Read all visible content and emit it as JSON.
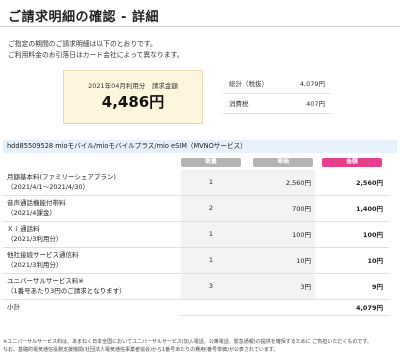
{
  "page": {
    "title": "ご請求明細の確認 - 詳細",
    "intro_line1": "ご指定の期間のご請求明細は以下のとおりです。",
    "intro_line2": "ご利用料金のお引落日はカード会社によって異なります。"
  },
  "total": {
    "caption": "2021年04月利用分　請求金額",
    "amount": "4,486円"
  },
  "summary": [
    {
      "label": "総計（税抜）",
      "value": "4,079円"
    },
    {
      "label": "消費税",
      "value": "407円"
    }
  ],
  "line": {
    "label": "hdd85509528 mioモバイル/mioモバイルプラス/mio eSIM（MVNOサービス）"
  },
  "columns": {
    "qty": "数量",
    "unit": "単価",
    "amount": "金額"
  },
  "colors": {
    "header_gray": "#b3b3b3",
    "header_pink": "#e6408c",
    "line_bar": "#e6f1fb",
    "total_box": "#fdf6dc"
  },
  "rows": [
    {
      "name1": "月額基本料(ファミリーシェアプラン)",
      "name2": "（2021/4/1〜2021/4/30）",
      "qty": "1",
      "unit": "2,560円",
      "amount": "2,560円"
    },
    {
      "name1": "音声通話機能付帯料",
      "name2": "（2021/4課金）",
      "qty": "2",
      "unit": "700円",
      "amount": "1,400円"
    },
    {
      "name1": "Ｘｉ通話料",
      "name2": "（2021/3利用分）",
      "qty": "1",
      "unit": "100円",
      "amount": "100円"
    },
    {
      "name1": "他社接続サービス通信料",
      "name2": "（2021/3利用分）",
      "qty": "1",
      "unit": "10円",
      "amount": "10円"
    },
    {
      "name1": "ユニバーサルサービス料※",
      "name2": "（1番号あたり3円のご請求となります）",
      "qty": "3",
      "unit": "3円",
      "amount": "9円"
    }
  ],
  "subtotal": {
    "label": "小計",
    "amount": "4,079円"
  },
  "footnote": {
    "line1": "※ユニバーサルサービス料は、あまねく日本全国においてユニバーサルサービス(加入電話、公衆電話、緊急通報)の提供を確保するために ご負担いただくものです。",
    "line2": "なお、基礎的電気通信役務支援機関(社団法人電気通信事業者協会)から1番号あたりの費用(番号単価)が公表されています。"
  }
}
